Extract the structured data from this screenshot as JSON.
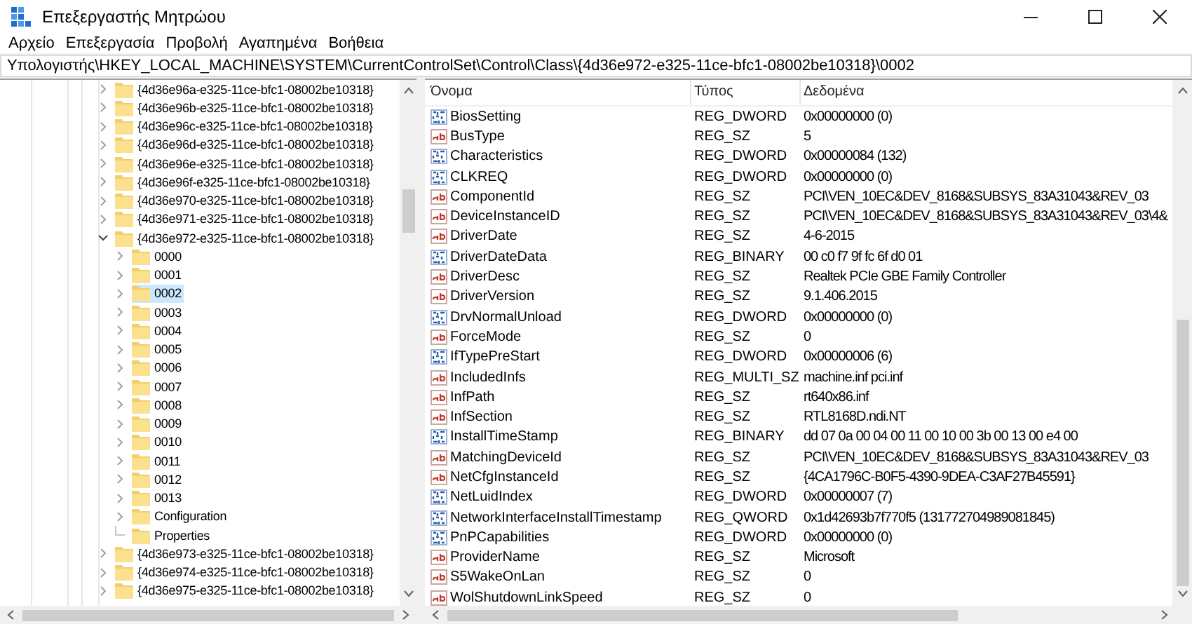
{
  "window": {
    "title": "Επεξεργαστής Μητρώου"
  },
  "menu": [
    "Αρχείο",
    "Επεξεργασία",
    "Προβολή",
    "Αγαπημένα",
    "Βοήθεια"
  ],
  "address": "Υπολογιστής\\HKEY_LOCAL_MACHINE\\SYSTEM\\CurrentControlSet\\Control\\Class\\{4d36e972-e325-11ce-bfc1-08002be10318}\\0002",
  "tree": [
    {
      "label": "{4d36e96a-e325-11ce-bfc1-08002be10318}",
      "kind": "branch",
      "expanded": false,
      "selected": false
    },
    {
      "label": "{4d36e96b-e325-11ce-bfc1-08002be10318}",
      "kind": "branch",
      "expanded": false,
      "selected": false
    },
    {
      "label": "{4d36e96c-e325-11ce-bfc1-08002be10318}",
      "kind": "branch",
      "expanded": false,
      "selected": false
    },
    {
      "label": "{4d36e96d-e325-11ce-bfc1-08002be10318}",
      "kind": "branch",
      "expanded": false,
      "selected": false
    },
    {
      "label": "{4d36e96e-e325-11ce-bfc1-08002be10318}",
      "kind": "branch",
      "expanded": false,
      "selected": false
    },
    {
      "label": "{4d36e96f-e325-11ce-bfc1-08002be10318}",
      "kind": "branch",
      "expanded": false,
      "selected": false
    },
    {
      "label": "{4d36e970-e325-11ce-bfc1-08002be10318}",
      "kind": "branch",
      "expanded": false,
      "selected": false
    },
    {
      "label": "{4d36e971-e325-11ce-bfc1-08002be10318}",
      "kind": "branch",
      "expanded": false,
      "selected": false
    },
    {
      "label": "{4d36e972-e325-11ce-bfc1-08002be10318}",
      "kind": "branch",
      "expanded": true,
      "selected": false,
      "children": [
        {
          "label": "0000",
          "kind": "branch",
          "expanded": false,
          "selected": false
        },
        {
          "label": "0001",
          "kind": "branch",
          "expanded": false,
          "selected": false
        },
        {
          "label": "0002",
          "kind": "branch",
          "expanded": false,
          "selected": true
        },
        {
          "label": "0003",
          "kind": "branch",
          "expanded": false,
          "selected": false
        },
        {
          "label": "0004",
          "kind": "branch",
          "expanded": false,
          "selected": false
        },
        {
          "label": "0005",
          "kind": "branch",
          "expanded": false,
          "selected": false
        },
        {
          "label": "0006",
          "kind": "branch",
          "expanded": false,
          "selected": false
        },
        {
          "label": "0007",
          "kind": "branch",
          "expanded": false,
          "selected": false
        },
        {
          "label": "0008",
          "kind": "branch",
          "expanded": false,
          "selected": false
        },
        {
          "label": "0009",
          "kind": "branch",
          "expanded": false,
          "selected": false
        },
        {
          "label": "0010",
          "kind": "branch",
          "expanded": false,
          "selected": false
        },
        {
          "label": "0011",
          "kind": "branch",
          "expanded": false,
          "selected": false
        },
        {
          "label": "0012",
          "kind": "branch",
          "expanded": false,
          "selected": false
        },
        {
          "label": "0013",
          "kind": "branch",
          "expanded": false,
          "selected": false
        },
        {
          "label": "Configuration",
          "kind": "branch",
          "expanded": false,
          "selected": false
        },
        {
          "label": "Properties",
          "kind": "leaf",
          "selected": false
        }
      ]
    },
    {
      "label": "{4d36e973-e325-11ce-bfc1-08002be10318}",
      "kind": "branch",
      "expanded": false,
      "selected": false
    },
    {
      "label": "{4d36e974-e325-11ce-bfc1-08002be10318}",
      "kind": "branch",
      "expanded": false,
      "selected": false
    },
    {
      "label": "{4d36e975-e325-11ce-bfc1-08002be10318}",
      "kind": "branch",
      "expanded": false,
      "selected": false
    }
  ],
  "columns": [
    "Όνομα",
    "Τύπος",
    "Δεδομένα"
  ],
  "values": [
    {
      "kind": "binary",
      "name": "BiosSetting",
      "type": "REG_DWORD",
      "data": "0x00000000 (0)"
    },
    {
      "kind": "string",
      "name": "BusType",
      "type": "REG_SZ",
      "data": "5"
    },
    {
      "kind": "binary",
      "name": "Characteristics",
      "type": "REG_DWORD",
      "data": "0x00000084 (132)"
    },
    {
      "kind": "binary",
      "name": "CLKREQ",
      "type": "REG_DWORD",
      "data": "0x00000000 (0)"
    },
    {
      "kind": "string",
      "name": "ComponentId",
      "type": "REG_SZ",
      "data": "PCI\\VEN_10EC&DEV_8168&SUBSYS_83A31043&REV_03"
    },
    {
      "kind": "string",
      "name": "DeviceInstanceID",
      "type": "REG_SZ",
      "data": "PCI\\VEN_10EC&DEV_8168&SUBSYS_83A31043&REV_03\\4&"
    },
    {
      "kind": "string",
      "name": "DriverDate",
      "type": "REG_SZ",
      "data": "4-6-2015"
    },
    {
      "kind": "binary",
      "name": "DriverDateData",
      "type": "REG_BINARY",
      "data": "00 c0 f7 9f fc 6f d0 01"
    },
    {
      "kind": "string",
      "name": "DriverDesc",
      "type": "REG_SZ",
      "data": "Realtek PCIe GBE Family Controller"
    },
    {
      "kind": "string",
      "name": "DriverVersion",
      "type": "REG_SZ",
      "data": "9.1.406.2015"
    },
    {
      "kind": "binary",
      "name": "DrvNormalUnload",
      "type": "REG_DWORD",
      "data": "0x00000000 (0)"
    },
    {
      "kind": "string",
      "name": "ForceMode",
      "type": "REG_SZ",
      "data": "0"
    },
    {
      "kind": "binary",
      "name": "IfTypePreStart",
      "type": "REG_DWORD",
      "data": "0x00000006 (6)"
    },
    {
      "kind": "string",
      "name": "IncludedInfs",
      "type": "REG_MULTI_SZ",
      "data": "machine.inf pci.inf"
    },
    {
      "kind": "string",
      "name": "InfPath",
      "type": "REG_SZ",
      "data": "rt640x86.inf"
    },
    {
      "kind": "string",
      "name": "InfSection",
      "type": "REG_SZ",
      "data": "RTL8168D.ndi.NT"
    },
    {
      "kind": "binary",
      "name": "InstallTimeStamp",
      "type": "REG_BINARY",
      "data": "dd 07 0a 00 04 00 11 00 10 00 3b 00 13 00 e4 00"
    },
    {
      "kind": "string",
      "name": "MatchingDeviceId",
      "type": "REG_SZ",
      "data": "PCI\\VEN_10EC&DEV_8168&SUBSYS_83A31043&REV_03"
    },
    {
      "kind": "string",
      "name": "NetCfgInstanceId",
      "type": "REG_SZ",
      "data": "{4CA1796C-B0F5-4390-9DEA-C3AF27B45591}"
    },
    {
      "kind": "binary",
      "name": "NetLuidIndex",
      "type": "REG_DWORD",
      "data": "0x00000007 (7)"
    },
    {
      "kind": "binary",
      "name": "NetworkInterfaceInstallTimestamp",
      "type": "REG_QWORD",
      "data": "0x1d42693b7f770f5 (131772704989081845)"
    },
    {
      "kind": "binary",
      "name": "PnPCapabilities",
      "type": "REG_DWORD",
      "data": "0x00000000 (0)"
    },
    {
      "kind": "string",
      "name": "ProviderName",
      "type": "REG_SZ",
      "data": "Microsoft"
    },
    {
      "kind": "string",
      "name": "S5WakeOnLan",
      "type": "REG_SZ",
      "data": "0"
    },
    {
      "kind": "string",
      "name": "WolShutdownLinkSpeed",
      "type": "REG_SZ",
      "data": "0"
    }
  ]
}
